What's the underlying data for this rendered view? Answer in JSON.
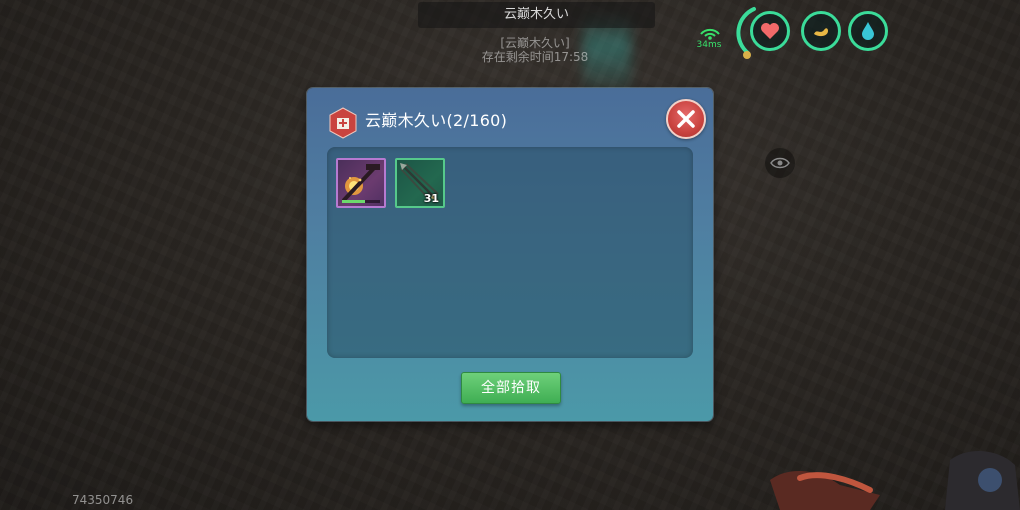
{
  "hud": {
    "top_bar_text": "云巅木久い",
    "world_name": "[云巅木久い]",
    "world_timer": "存在剩余时间17:58",
    "ping": "34ms",
    "player_id": "74350746",
    "status_icons": [
      "heart-icon",
      "stamina-icon",
      "water-drop-icon"
    ]
  },
  "dialog": {
    "title": "云巅木久い(2/160)",
    "items": [
      {
        "name": "weapon-item",
        "rarity_color": "#b77ad1",
        "durability": 0.6
      },
      {
        "name": "arrow-bundle-item",
        "rarity_color": "#56c98b",
        "count": "31"
      }
    ],
    "pickup_all_label": "全部拾取"
  },
  "colors": {
    "accent": "#3bdc9a",
    "close": "#c9433f",
    "pickup": "#3fae53"
  }
}
